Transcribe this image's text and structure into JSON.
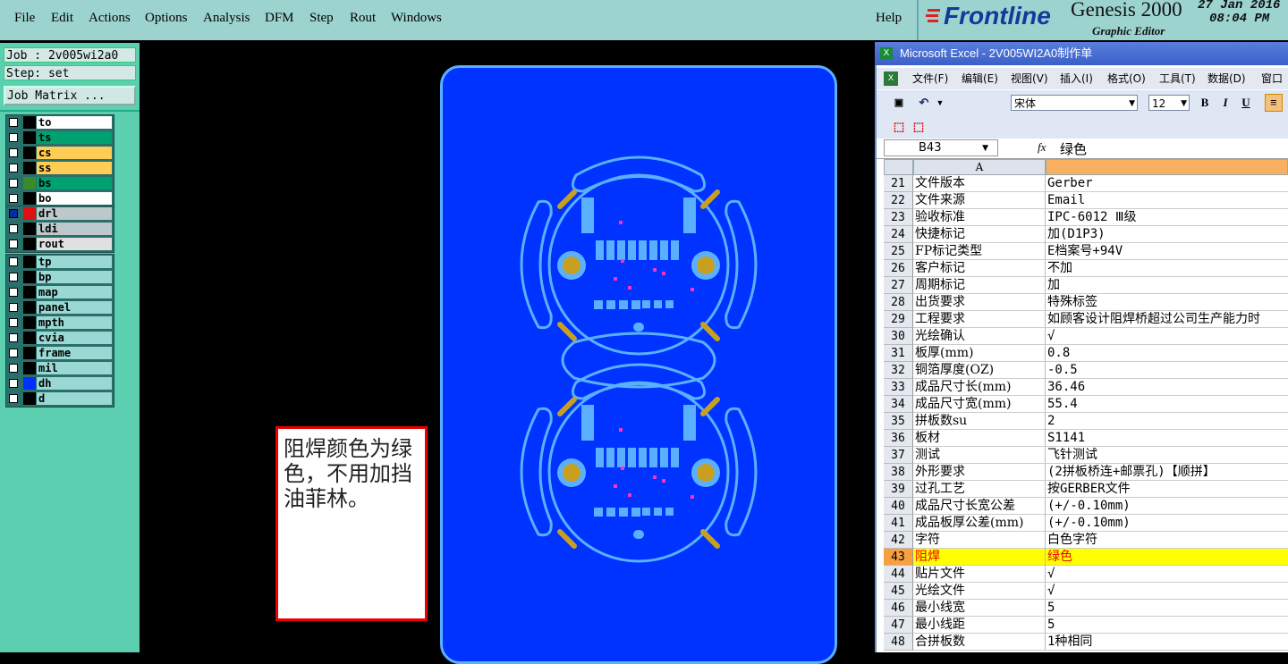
{
  "menubar": {
    "items": [
      "File",
      "Edit",
      "Actions",
      "Options",
      "Analysis",
      "DFM",
      "Step",
      "Rout",
      "Windows"
    ],
    "help": "Help"
  },
  "logo": {
    "brand": "Frontline",
    "product": "Genesis 2000",
    "subtitle": "Graphic Editor",
    "date": "27 Jan 2016",
    "time": "08:04 PM"
  },
  "left": {
    "job": "Job : 2v005wi2a0",
    "step": "Step: set",
    "job_matrix": "Job Matrix ...",
    "group1": [
      {
        "name": "to",
        "color": "#ffffff"
      },
      {
        "name": "ts",
        "color": "#00a070"
      },
      {
        "name": "cs",
        "color": "#ffcc55"
      },
      {
        "name": "ss",
        "color": "#ffcc55"
      },
      {
        "name": "bs",
        "color": "#00a070"
      },
      {
        "name": "bo",
        "color": "#ffffff"
      }
    ],
    "group2": [
      {
        "name": "drl",
        "color": "#bcc8cc"
      },
      {
        "name": "ldi",
        "color": "#bcc8cc"
      },
      {
        "name": "rout",
        "color": "#e0e0e0"
      }
    ],
    "group3": [
      {
        "name": "tp",
        "color": "#9ad8d4"
      },
      {
        "name": "bp",
        "color": "#9ad8d4"
      },
      {
        "name": "map",
        "color": "#9ad8d4"
      },
      {
        "name": "panel",
        "color": "#9ad8d4"
      },
      {
        "name": "mpth",
        "color": "#9ad8d4"
      },
      {
        "name": "cvia",
        "color": "#9ad8d4"
      },
      {
        "name": "frame",
        "color": "#9ad8d4"
      },
      {
        "name": "mil",
        "color": "#9ad8d4"
      },
      {
        "name": "dh",
        "color": "#9ad8d4"
      },
      {
        "name": "d",
        "color": "#9ad8d4"
      }
    ]
  },
  "note": {
    "text": "阻焊颜色为绿色，不用加挡油菲林。"
  },
  "excel": {
    "title": "Microsoft Excel - 2V005WI2A0制作单",
    "menu": [
      "文件(F)",
      "编辑(E)",
      "视图(V)",
      "插入(I)",
      "格式(O)",
      "工具(T)",
      "数据(D)",
      "窗口"
    ],
    "font": "宋体",
    "size": "12",
    "namebox": "B43",
    "fx": "fx",
    "formula": "绿色",
    "col_a": "A",
    "rows": [
      {
        "n": "21",
        "a": "文件版本",
        "b": "Gerber"
      },
      {
        "n": "22",
        "a": "文件来源",
        "b": "Email"
      },
      {
        "n": "23",
        "a": "验收标准",
        "b": "IPC-6012 Ⅲ级"
      },
      {
        "n": "24",
        "a": "快捷标记",
        "b": "加(D1P3)"
      },
      {
        "n": "25",
        "a": "FP标记类型",
        "b": "E档案号+94V"
      },
      {
        "n": "26",
        "a": "客户标记",
        "b": "不加"
      },
      {
        "n": "27",
        "a": "周期标记",
        "b": "加"
      },
      {
        "n": "28",
        "a": "出货要求",
        "b": "特殊标签"
      },
      {
        "n": "29",
        "a": "工程要求",
        "b": "如顾客设计阻焊桥超过公司生产能力时"
      },
      {
        "n": "30",
        "a": "光绘确认",
        "b": "√"
      },
      {
        "n": "31",
        "a": "板厚(mm)",
        "b": "0.8"
      },
      {
        "n": "32",
        "a": "铜箔厚度(OZ)",
        "b": "-0.5"
      },
      {
        "n": "33",
        "a": "成品尺寸长(mm)",
        "b": "36.46"
      },
      {
        "n": "34",
        "a": "成品尺寸宽(mm)",
        "b": "55.4"
      },
      {
        "n": "35",
        "a": "拼板数su",
        "b": "2"
      },
      {
        "n": "36",
        "a": "板材",
        "b": "S1141"
      },
      {
        "n": "37",
        "a": "测试",
        "b": "飞针测试"
      },
      {
        "n": "38",
        "a": "外形要求",
        "b": "(2拼板桥连+邮票孔)【顺拼】"
      },
      {
        "n": "39",
        "a": "过孔工艺",
        "b": "按GERBER文件"
      },
      {
        "n": "40",
        "a": "成品尺寸长宽公差",
        "b": "(+/-0.10mm)"
      },
      {
        "n": "41",
        "a": "成品板厚公差(mm)",
        "b": "(+/-0.10mm)"
      },
      {
        "n": "42",
        "a": "字符",
        "b": "白色字符"
      },
      {
        "n": "43",
        "a": "阻焊",
        "b": "绿色"
      },
      {
        "n": "44",
        "a": "贴片文件",
        "b": "√"
      },
      {
        "n": "45",
        "a": "光绘文件",
        "b": "√"
      },
      {
        "n": "46",
        "a": "最小线宽",
        "b": "5"
      },
      {
        "n": "47",
        "a": "最小线距",
        "b": "5"
      },
      {
        "n": "48",
        "a": "合拼板数",
        "b": "1种相同"
      }
    ]
  }
}
